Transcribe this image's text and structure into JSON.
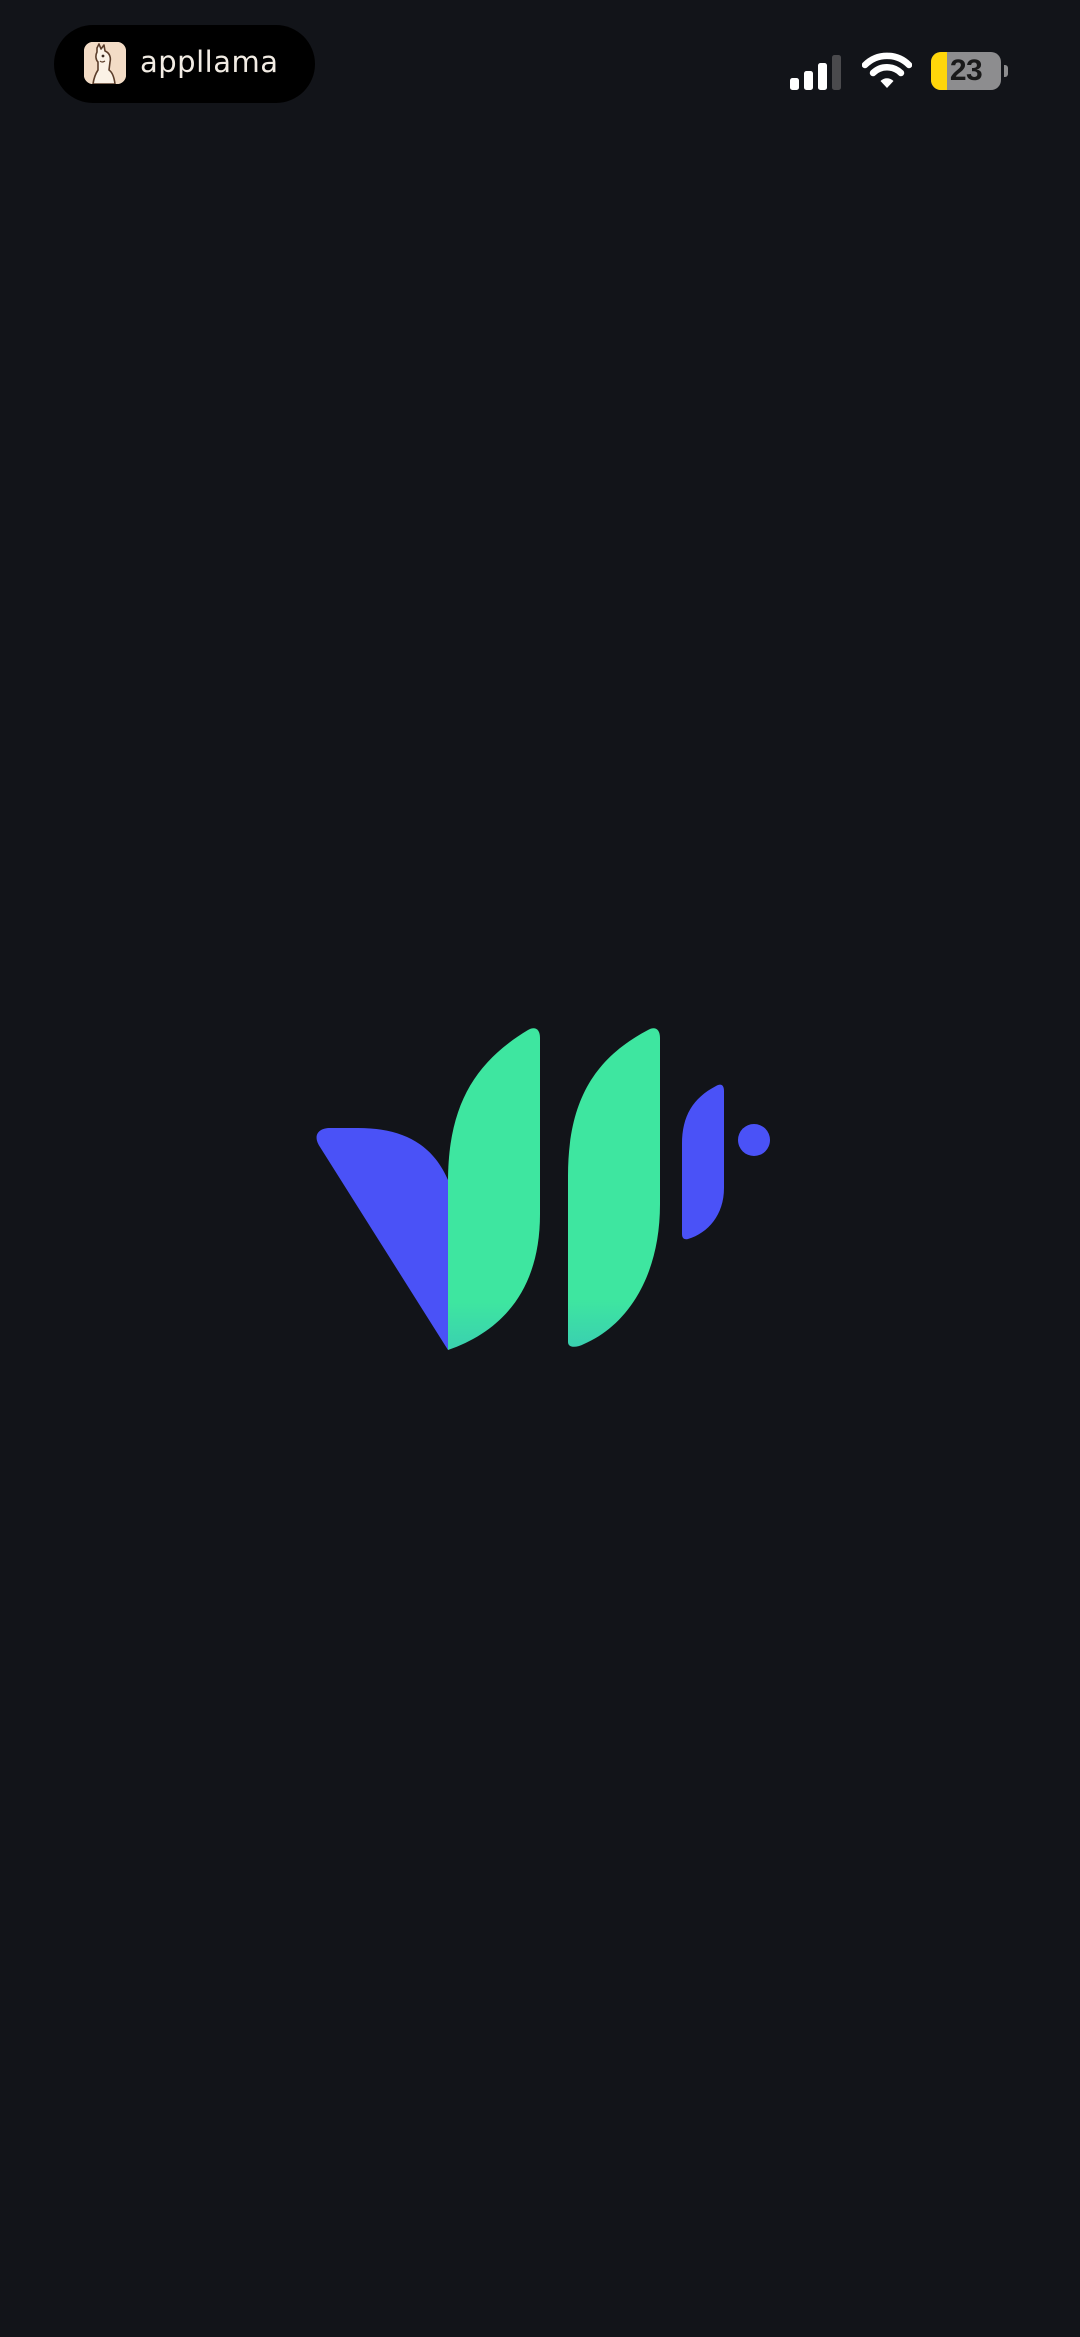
{
  "status_bar": {
    "app_name": "appllama",
    "battery_level": "23",
    "battery_fraction": 0.23,
    "signal_bars_active": 3,
    "signal_bars_total": 4
  },
  "icons": {
    "app_icon": "llama-icon",
    "signal": "cellular-signal-icon",
    "wifi": "wifi-icon",
    "battery": "battery-icon"
  },
  "colors": {
    "background": "#121419",
    "logo_green": "#3ee6a0",
    "logo_blue": "#4a52f7",
    "battery_fill": "#ffd60a",
    "battery_empty": "#8d8d8f"
  }
}
